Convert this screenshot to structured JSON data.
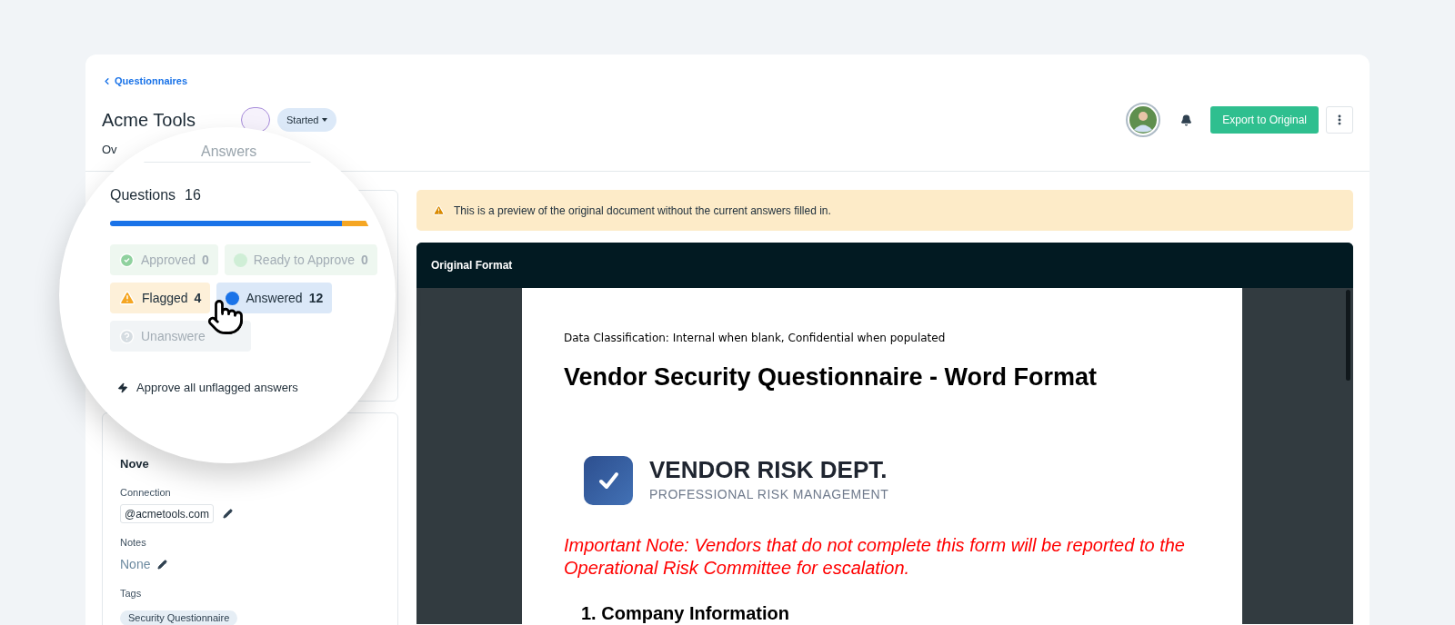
{
  "breadcrumb": {
    "label": "Questionnaires"
  },
  "title": "Acme Tools",
  "status": {
    "label": "Started"
  },
  "tab": {
    "label": "Ov"
  },
  "actions": {
    "export": "Export to Original"
  },
  "magnifier": {
    "tab_label": "Answers",
    "questions": {
      "label": "Questions",
      "count": "16"
    },
    "progress": [
      {
        "level": 0.75,
        "color": "#1a73e8"
      },
      {
        "level": 0.25,
        "color": "#f5a623"
      }
    ],
    "statuses": [
      {
        "kind": "approved",
        "label": "Approved",
        "count": "0",
        "color": "#8fd19e",
        "disabled": true
      },
      {
        "kind": "ready",
        "label": "Ready to Approve",
        "count": "0",
        "color": "#cfeed6",
        "disabled": true
      },
      {
        "kind": "flagged",
        "label": "Flagged",
        "count": "4",
        "color": "#f5a623",
        "disabled": false
      },
      {
        "kind": "answered",
        "label": "Answered",
        "count": "12",
        "color": "#1a73e8",
        "disabled": false
      },
      {
        "kind": "unanswered",
        "label": "Unanswere",
        "color": "#d5dce1",
        "disabled": true
      }
    ],
    "approve_all": "Approve all unflagged answers"
  },
  "details": {
    "heading": "Nove",
    "fields": [
      {
        "kind": "chip",
        "label": "Connection",
        "value": "@acmetools.com"
      },
      {
        "kind": "muted",
        "label": "Notes",
        "value": "None"
      },
      {
        "kind": "tag",
        "label": "Tags",
        "value": "Security Questionnaire"
      }
    ]
  },
  "notice": "This is a preview of the original document without the current answers filled in.",
  "viewer": {
    "title": "Original Format",
    "document": {
      "classification": "Data Classification: Internal when blank, Confidential when populated",
      "title": "Vendor Security Questionnaire - Word Format",
      "logo": {
        "name": "VENDOR RISK DEPT.",
        "tagline": "PROFESSIONAL RISK MANAGEMENT"
      },
      "note": "Important Note: Vendors that do not complete this form will be reported to the Operational Risk Committee for escalation.",
      "section": "1. Company Information"
    }
  }
}
